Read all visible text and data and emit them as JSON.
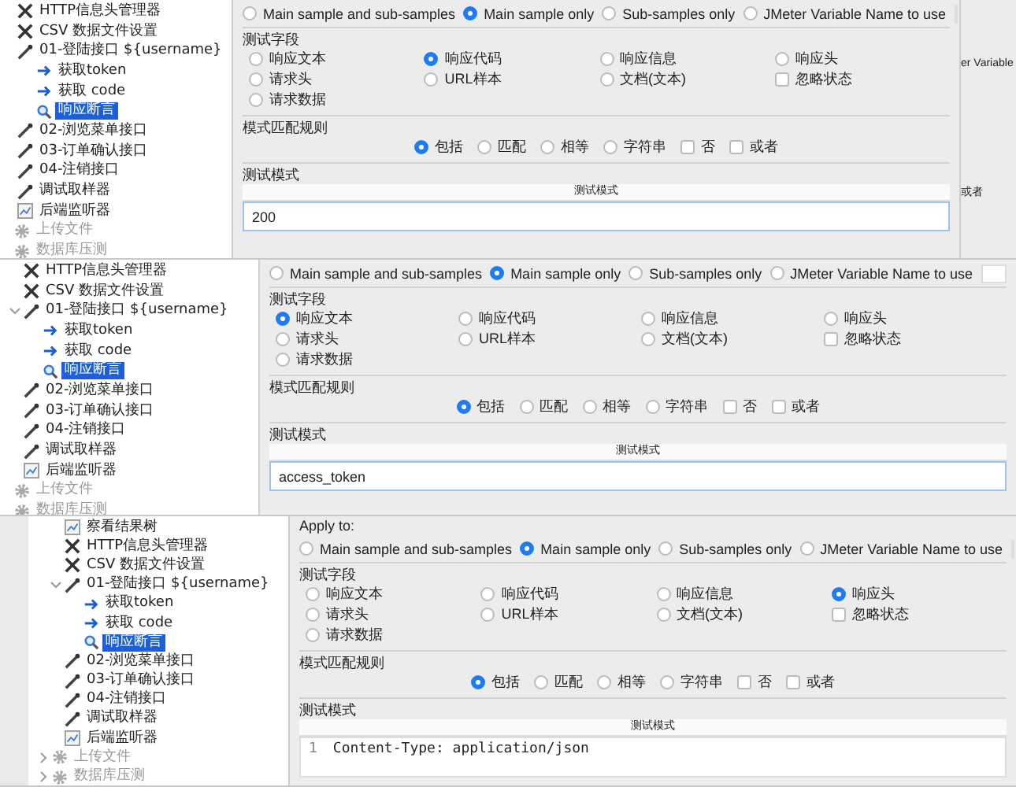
{
  "panels": [
    {
      "tree": [
        {
          "label": "HTTP信息头管理器",
          "kind": "config",
          "selected": false,
          "disabled": false
        },
        {
          "label": "CSV 数据文件设置",
          "kind": "config",
          "selected": false,
          "disabled": false
        },
        {
          "label": "01-登陆接口 ${username}",
          "kind": "sampler",
          "selected": false,
          "disabled": false,
          "children": [
            {
              "label": "获取token",
              "kind": "extractor",
              "selected": false,
              "disabled": false
            },
            {
              "label": "获取 code",
              "kind": "extractor",
              "selected": false,
              "disabled": false
            },
            {
              "label": "响应断言",
              "kind": "assertion",
              "selected": true,
              "disabled": false
            }
          ]
        },
        {
          "label": "02-浏览菜单接口",
          "kind": "sampler",
          "selected": false,
          "disabled": false
        },
        {
          "label": "03-订单确认接口",
          "kind": "sampler",
          "selected": false,
          "disabled": false
        },
        {
          "label": "04-注销接口",
          "kind": "sampler",
          "selected": false,
          "disabled": false
        },
        {
          "label": "调试取样器",
          "kind": "sampler",
          "selected": false,
          "disabled": false
        },
        {
          "label": "后端监听器",
          "kind": "listener",
          "selected": false,
          "disabled": false
        },
        {
          "label": "上传文件",
          "kind": "group",
          "selected": false,
          "disabled": true
        },
        {
          "label": "数据库压测",
          "kind": "group",
          "selected": false,
          "disabled": true
        }
      ],
      "apply_to": {
        "options": [
          {
            "label": "Main sample and sub-samples",
            "selected": false
          },
          {
            "label": "Main sample only",
            "selected": true
          },
          {
            "label": "Sub-samples only",
            "selected": false
          },
          {
            "label": "JMeter Variable Name to use",
            "selected": false
          }
        ]
      },
      "test_field": {
        "title": "测试字段",
        "options": [
          {
            "label": "响应文本",
            "kind": "radio",
            "selected": false
          },
          {
            "label": "响应代码",
            "kind": "radio",
            "selected": true
          },
          {
            "label": "响应信息",
            "kind": "radio",
            "selected": false
          },
          {
            "label": "响应头",
            "kind": "radio",
            "selected": false
          },
          {
            "label": "请求头",
            "kind": "radio",
            "selected": false
          },
          {
            "label": "URL样本",
            "kind": "radio",
            "selected": false
          },
          {
            "label": "文档(文本)",
            "kind": "radio",
            "selected": false
          },
          {
            "label": "忽略状态",
            "kind": "checkbox",
            "checked": false
          },
          {
            "label": "请求数据",
            "kind": "radio",
            "selected": false
          }
        ]
      },
      "match_rules": {
        "title": "模式匹配规则",
        "options": [
          {
            "label": "包括",
            "kind": "radio",
            "selected": true
          },
          {
            "label": "匹配",
            "kind": "radio",
            "selected": false
          },
          {
            "label": "相等",
            "kind": "radio",
            "selected": false
          },
          {
            "label": "字符串",
            "kind": "radio",
            "selected": false
          },
          {
            "label": "否",
            "kind": "checkbox",
            "checked": false
          },
          {
            "label": "或者",
            "kind": "checkbox",
            "checked": false
          }
        ]
      },
      "pattern": {
        "title": "测试模式",
        "column": "测试模式",
        "value": "200"
      },
      "fragments": [
        "er Variable",
        "或者"
      ]
    },
    {
      "tree": [
        {
          "label": "HTTP信息头管理器",
          "kind": "config",
          "selected": false,
          "disabled": false
        },
        {
          "label": "CSV 数据文件设置",
          "kind": "config",
          "selected": false,
          "disabled": false
        },
        {
          "label": "01-登陆接口 ${username}",
          "kind": "sampler",
          "selected": false,
          "disabled": false,
          "expanded": true,
          "children": [
            {
              "label": "获取token",
              "kind": "extractor",
              "selected": false,
              "disabled": false
            },
            {
              "label": "获取 code",
              "kind": "extractor",
              "selected": false,
              "disabled": false
            },
            {
              "label": "响应断言",
              "kind": "assertion",
              "selected": true,
              "disabled": false
            }
          ]
        },
        {
          "label": "02-浏览菜单接口",
          "kind": "sampler",
          "selected": false,
          "disabled": false
        },
        {
          "label": "03-订单确认接口",
          "kind": "sampler",
          "selected": false,
          "disabled": false
        },
        {
          "label": "04-注销接口",
          "kind": "sampler",
          "selected": false,
          "disabled": false
        },
        {
          "label": "调试取样器",
          "kind": "sampler",
          "selected": false,
          "disabled": false
        },
        {
          "label": "后端监听器",
          "kind": "listener",
          "selected": false,
          "disabled": false
        },
        {
          "label": "上传文件",
          "kind": "group",
          "selected": false,
          "disabled": true
        },
        {
          "label": "数据库压测",
          "kind": "group",
          "selected": false,
          "disabled": true
        }
      ],
      "apply_to": {
        "options": [
          {
            "label": "Main sample and sub-samples",
            "selected": false
          },
          {
            "label": "Main sample only",
            "selected": true
          },
          {
            "label": "Sub-samples only",
            "selected": false
          },
          {
            "label": "JMeter Variable Name to use",
            "selected": false
          }
        ]
      },
      "test_field": {
        "title": "测试字段",
        "options": [
          {
            "label": "响应文本",
            "kind": "radio",
            "selected": true
          },
          {
            "label": "响应代码",
            "kind": "radio",
            "selected": false
          },
          {
            "label": "响应信息",
            "kind": "radio",
            "selected": false
          },
          {
            "label": "响应头",
            "kind": "radio",
            "selected": false
          },
          {
            "label": "请求头",
            "kind": "radio",
            "selected": false
          },
          {
            "label": "URL样本",
            "kind": "radio",
            "selected": false
          },
          {
            "label": "文档(文本)",
            "kind": "radio",
            "selected": false
          },
          {
            "label": "忽略状态",
            "kind": "checkbox",
            "checked": false
          },
          {
            "label": "请求数据",
            "kind": "radio",
            "selected": false
          }
        ]
      },
      "match_rules": {
        "title": "模式匹配规则",
        "options": [
          {
            "label": "包括",
            "kind": "radio",
            "selected": true
          },
          {
            "label": "匹配",
            "kind": "radio",
            "selected": false
          },
          {
            "label": "相等",
            "kind": "radio",
            "selected": false
          },
          {
            "label": "字符串",
            "kind": "radio",
            "selected": false
          },
          {
            "label": "否",
            "kind": "checkbox",
            "checked": false
          },
          {
            "label": "或者",
            "kind": "checkbox",
            "checked": false
          }
        ]
      },
      "pattern": {
        "title": "测试模式",
        "column": "测试模式",
        "value": "access_token"
      }
    },
    {
      "tree": [
        {
          "label": "察看结果树",
          "kind": "listener",
          "selected": false,
          "disabled": false
        },
        {
          "label": "HTTP信息头管理器",
          "kind": "config",
          "selected": false,
          "disabled": false
        },
        {
          "label": "CSV 数据文件设置",
          "kind": "config",
          "selected": false,
          "disabled": false
        },
        {
          "label": "01-登陆接口 ${username}",
          "kind": "sampler",
          "selected": false,
          "disabled": false,
          "expanded": true,
          "children": [
            {
              "label": "获取token",
              "kind": "extractor",
              "selected": false,
              "disabled": false
            },
            {
              "label": "获取 code",
              "kind": "extractor",
              "selected": false,
              "disabled": false
            },
            {
              "label": "响应断言",
              "kind": "assertion",
              "selected": true,
              "disabled": false
            }
          ]
        },
        {
          "label": "02-浏览菜单接口",
          "kind": "sampler",
          "selected": false,
          "disabled": false
        },
        {
          "label": "03-订单确认接口",
          "kind": "sampler",
          "selected": false,
          "disabled": false
        },
        {
          "label": "04-注销接口",
          "kind": "sampler",
          "selected": false,
          "disabled": false
        },
        {
          "label": "调试取样器",
          "kind": "sampler",
          "selected": false,
          "disabled": false
        },
        {
          "label": "后端监听器",
          "kind": "listener",
          "selected": false,
          "disabled": false
        },
        {
          "label": "上传文件",
          "kind": "group",
          "selected": false,
          "disabled": true,
          "expanded": false
        },
        {
          "label": "数据库压测",
          "kind": "group",
          "selected": false,
          "disabled": true,
          "expanded": false
        }
      ],
      "apply_to": {
        "label": "Apply to:",
        "options": [
          {
            "label": "Main sample and sub-samples",
            "selected": false
          },
          {
            "label": "Main sample only",
            "selected": true
          },
          {
            "label": "Sub-samples only",
            "selected": false
          },
          {
            "label": "JMeter Variable Name to use",
            "selected": false
          }
        ]
      },
      "test_field": {
        "title": "测试字段",
        "options": [
          {
            "label": "响应文本",
            "kind": "radio",
            "selected": false
          },
          {
            "label": "响应代码",
            "kind": "radio",
            "selected": false
          },
          {
            "label": "响应信息",
            "kind": "radio",
            "selected": false
          },
          {
            "label": "响应头",
            "kind": "radio",
            "selected": true
          },
          {
            "label": "请求头",
            "kind": "radio",
            "selected": false
          },
          {
            "label": "URL样本",
            "kind": "radio",
            "selected": false
          },
          {
            "label": "文档(文本)",
            "kind": "radio",
            "selected": false
          },
          {
            "label": "忽略状态",
            "kind": "checkbox",
            "checked": false
          },
          {
            "label": "请求数据",
            "kind": "radio",
            "selected": false
          }
        ]
      },
      "match_rules": {
        "title": "模式匹配规则",
        "options": [
          {
            "label": "包括",
            "kind": "radio",
            "selected": true
          },
          {
            "label": "匹配",
            "kind": "radio",
            "selected": false
          },
          {
            "label": "相等",
            "kind": "radio",
            "selected": false
          },
          {
            "label": "字符串",
            "kind": "radio",
            "selected": false
          },
          {
            "label": "否",
            "kind": "checkbox",
            "checked": false
          },
          {
            "label": "或者",
            "kind": "checkbox",
            "checked": false
          }
        ]
      },
      "pattern": {
        "title": "测试模式",
        "column": "测试模式",
        "line_number": "1",
        "value": "Content-Type: application/json"
      }
    }
  ]
}
